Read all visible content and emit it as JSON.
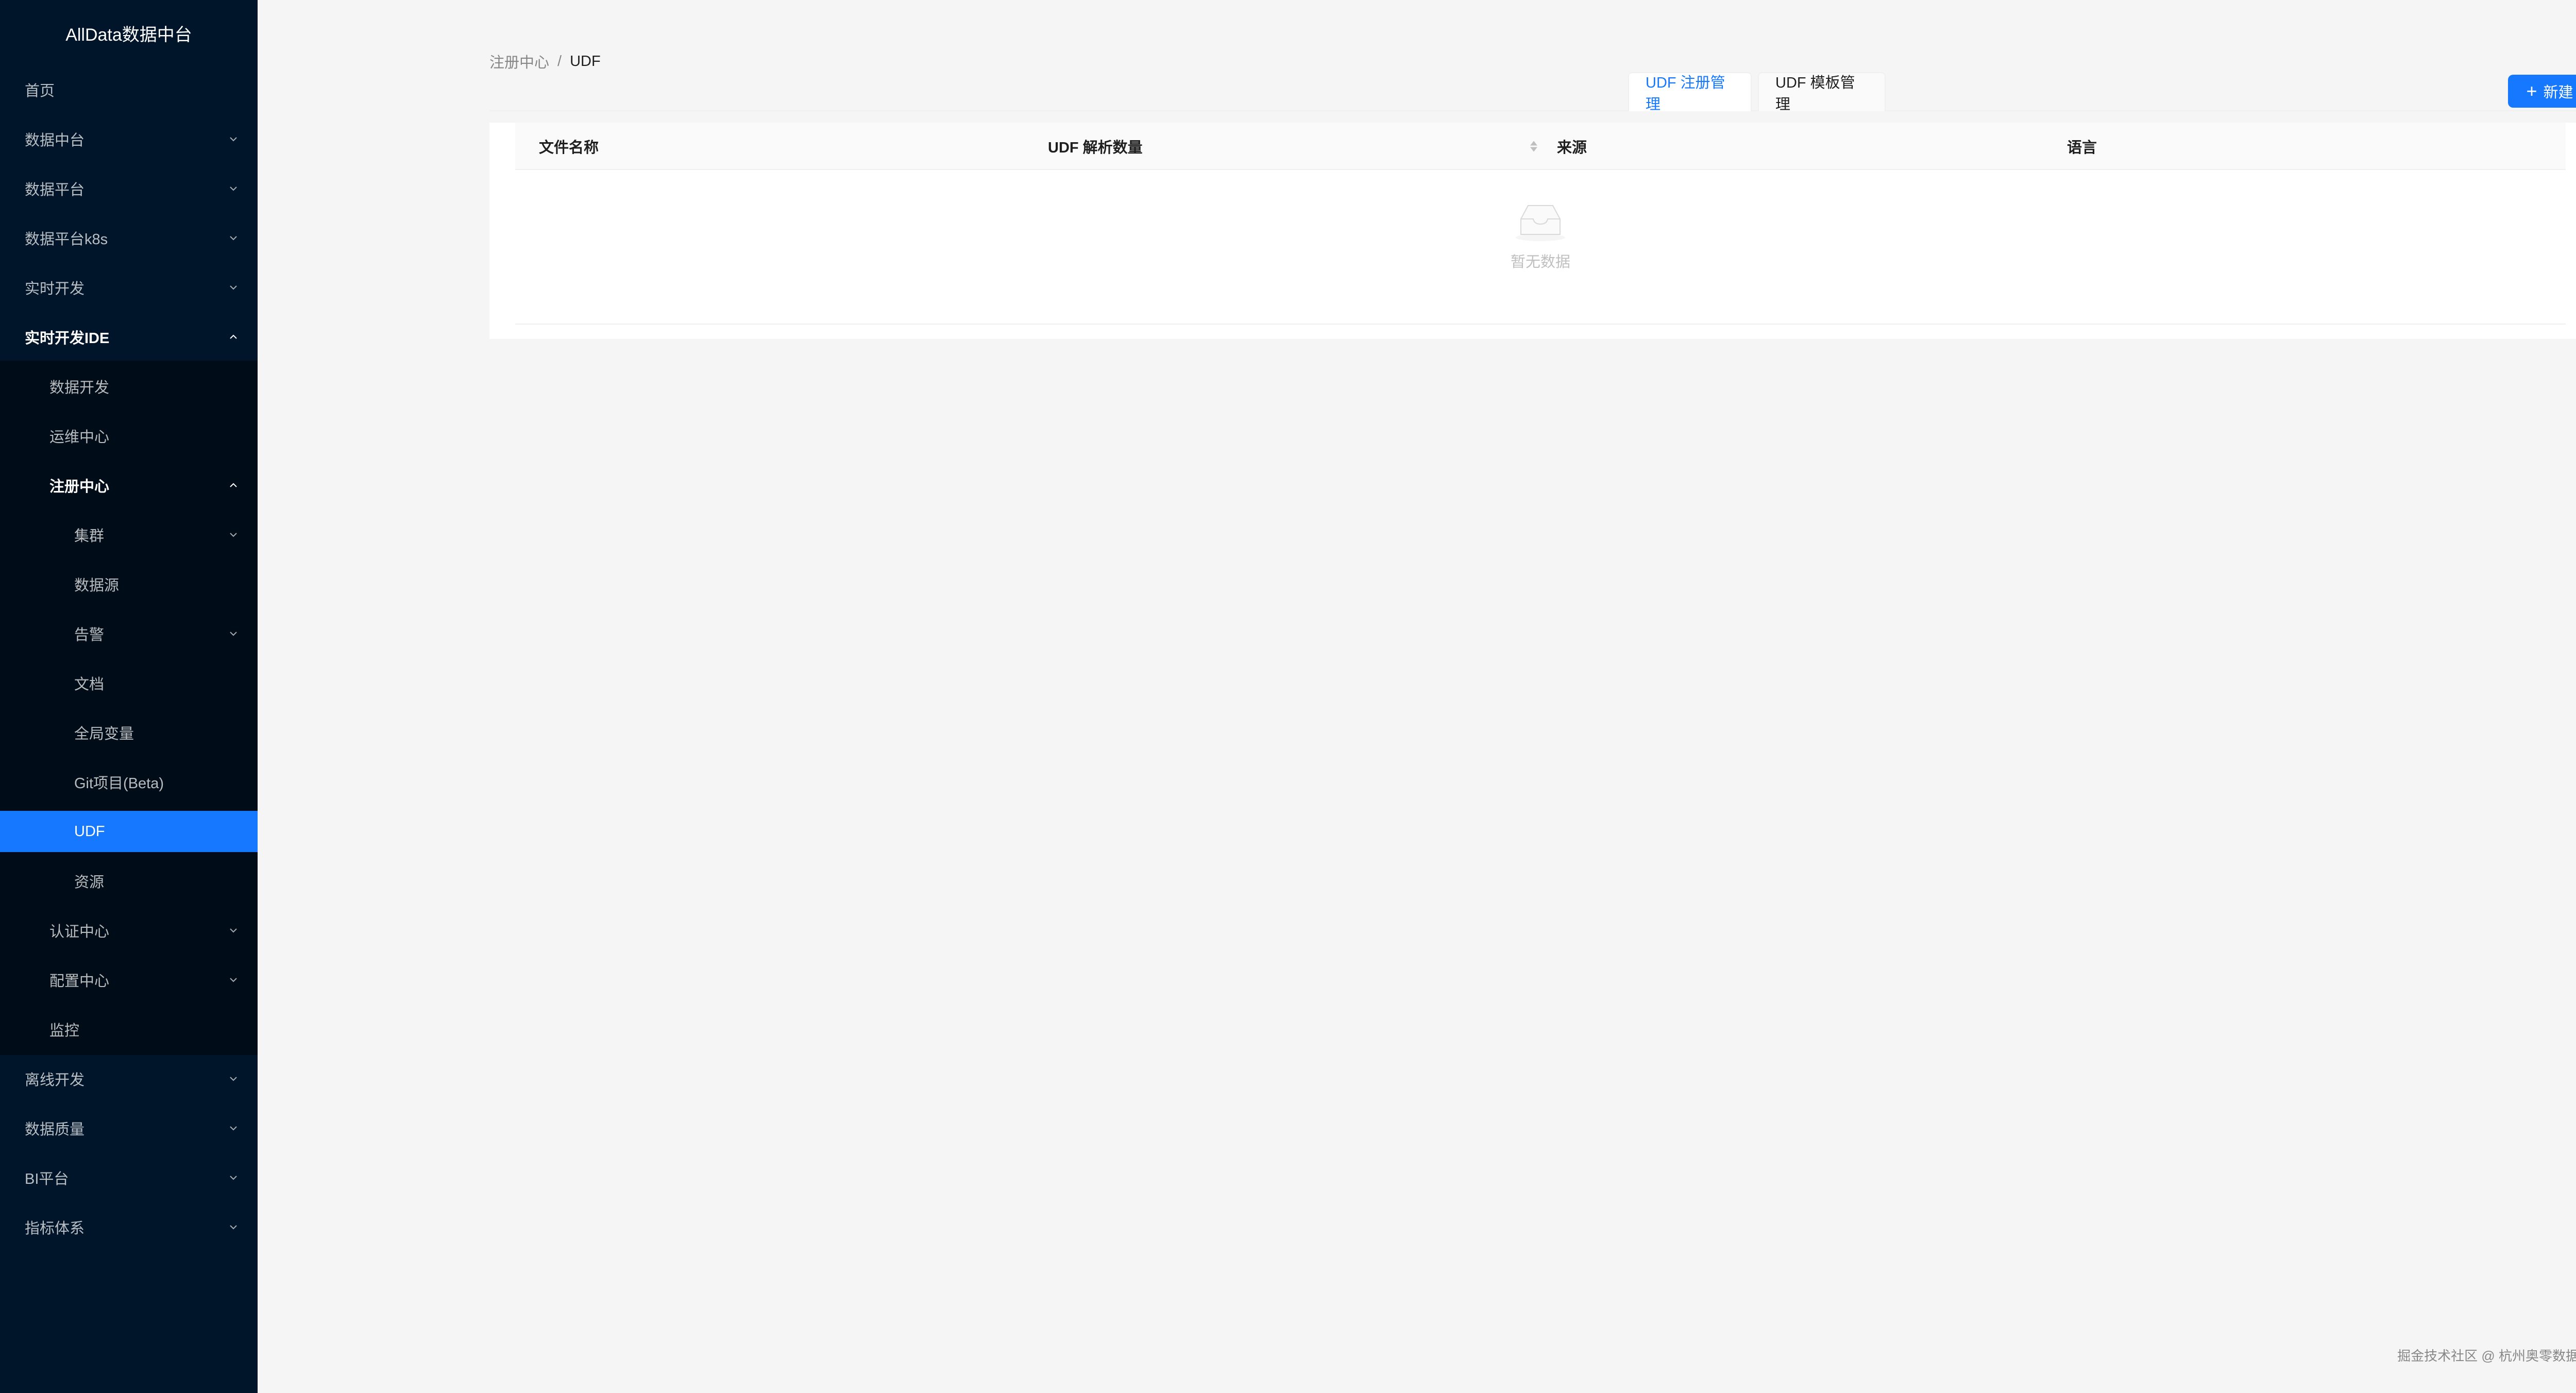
{
  "app": {
    "title": "AllData数据中台"
  },
  "sidebar": {
    "items": [
      {
        "label": "首页"
      },
      {
        "label": "数据中台"
      },
      {
        "label": "数据平台"
      },
      {
        "label": "数据平台k8s"
      },
      {
        "label": "实时开发"
      },
      {
        "label": "实时开发IDE"
      },
      {
        "label": "数据开发"
      },
      {
        "label": "运维中心"
      },
      {
        "label": "注册中心"
      },
      {
        "label": "集群"
      },
      {
        "label": "数据源"
      },
      {
        "label": "告警"
      },
      {
        "label": "文档"
      },
      {
        "label": "全局变量"
      },
      {
        "label": "Git项目(Beta)"
      },
      {
        "label": "UDF"
      },
      {
        "label": "资源"
      },
      {
        "label": "认证中心"
      },
      {
        "label": "配置中心"
      },
      {
        "label": "监控"
      },
      {
        "label": "离线开发"
      },
      {
        "label": "数据质量"
      },
      {
        "label": "BI平台"
      },
      {
        "label": "指标体系"
      }
    ]
  },
  "breadcrumb": {
    "parent": "注册中心",
    "separator": "/",
    "current": "UDF"
  },
  "tabs": [
    {
      "label": "UDF 注册管理",
      "active": true
    },
    {
      "label": "UDF 模板管理",
      "active": false
    }
  ],
  "toolbar": {
    "new_label": "新建",
    "accent": "#1677ff"
  },
  "table": {
    "columns": [
      "文件名称",
      "UDF 解析数量",
      "来源",
      "语言"
    ],
    "empty_text": "暂无数据"
  },
  "footer": {
    "text": "掘金技术社区 @ 杭州奥零数据科技"
  }
}
